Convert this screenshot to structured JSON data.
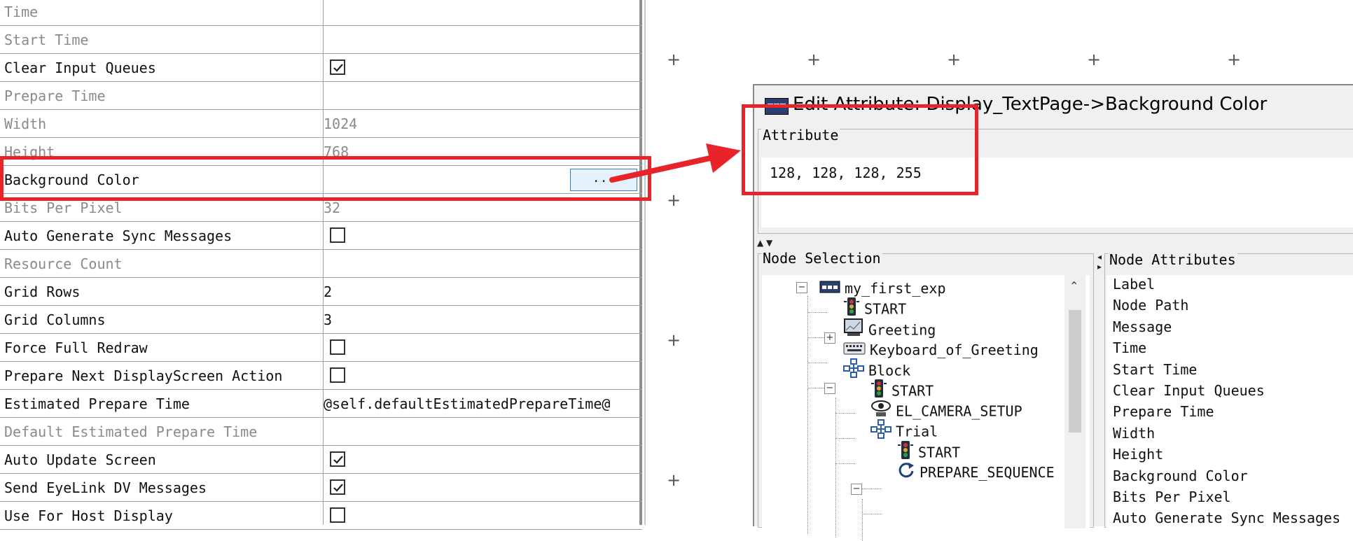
{
  "property_grid": {
    "rows": [
      {
        "name": "Time",
        "value": "",
        "readonly": true,
        "kind": "text"
      },
      {
        "name": "Start Time",
        "value": "",
        "readonly": true,
        "kind": "text"
      },
      {
        "name": "Clear Input Queues",
        "value": "",
        "readonly": false,
        "kind": "checkbox",
        "checked": true
      },
      {
        "name": "Prepare Time",
        "value": "",
        "readonly": true,
        "kind": "text"
      },
      {
        "name": "Width",
        "value": "1024",
        "readonly": true,
        "kind": "text"
      },
      {
        "name": "Height",
        "value": "768",
        "readonly": true,
        "kind": "text"
      },
      {
        "name": "Background Color",
        "value": "",
        "readonly": false,
        "kind": "button"
      },
      {
        "name": "Bits Per Pixel",
        "value": "32",
        "readonly": true,
        "kind": "text"
      },
      {
        "name": "Auto Generate Sync Messages",
        "value": "",
        "readonly": false,
        "kind": "checkbox",
        "checked": false
      },
      {
        "name": "Resource Count",
        "value": "",
        "readonly": true,
        "kind": "text"
      },
      {
        "name": "Grid Rows",
        "value": "2",
        "readonly": false,
        "kind": "text"
      },
      {
        "name": "Grid Columns",
        "value": "3",
        "readonly": false,
        "kind": "text"
      },
      {
        "name": "Force Full Redraw",
        "value": "",
        "readonly": false,
        "kind": "checkbox",
        "checked": false
      },
      {
        "name": "Prepare Next DisplayScreen Action",
        "value": "",
        "readonly": false,
        "kind": "checkbox",
        "checked": false
      },
      {
        "name": "Estimated Prepare Time",
        "value": "@self.defaultEstimatedPrepareTime@",
        "readonly": false,
        "kind": "text"
      },
      {
        "name": "Default Estimated Prepare Time",
        "value": "",
        "readonly": true,
        "kind": "text"
      },
      {
        "name": "Auto Update Screen",
        "value": "",
        "readonly": false,
        "kind": "checkbox",
        "checked": true
      },
      {
        "name": "Send EyeLink DV Messages",
        "value": "",
        "readonly": false,
        "kind": "checkbox",
        "checked": true
      },
      {
        "name": "Use For Host Display",
        "value": "",
        "readonly": false,
        "kind": "checkbox",
        "checked": false
      }
    ],
    "background_color_button_label": "..."
  },
  "edit_window": {
    "title": "Edit Attribute: Display_TextPage->Background Color",
    "attribute_group_label": "Attribute",
    "attribute_value": "128, 128, 128, 255",
    "node_selection_label": "Node Selection",
    "node_attributes_label": "Node Attributes",
    "tree": [
      {
        "label": "my_first_exp",
        "icon": "experiment-icon"
      },
      {
        "label": "START",
        "icon": "traffic-light-icon"
      },
      {
        "label": "Greeting",
        "icon": "display-screen-icon"
      },
      {
        "label": "Keyboard_of_Greeting",
        "icon": "keyboard-icon"
      },
      {
        "label": "Block",
        "icon": "sequence-block-icon"
      },
      {
        "label": "START",
        "icon": "traffic-light-icon"
      },
      {
        "label": "EL_CAMERA_SETUP",
        "icon": "eye-icon"
      },
      {
        "label": "Trial",
        "icon": "sequence-block-icon"
      },
      {
        "label": "START",
        "icon": "traffic-light-icon"
      },
      {
        "label": "PREPARE_SEQUENCE",
        "icon": "refresh-icon"
      }
    ],
    "node_attributes": [
      "Label",
      "Node Path",
      "Message",
      "Time",
      "Start Time",
      "Clear Input Queues",
      "Prepare Time",
      "Width",
      "Height",
      "Background Color",
      "Bits Per Pixel",
      "Auto Generate Sync Messages"
    ]
  },
  "colors": {
    "highlight": "#e8232a",
    "readonly_text": "#8a8a8a",
    "button_fill": "#e5f1fb"
  }
}
